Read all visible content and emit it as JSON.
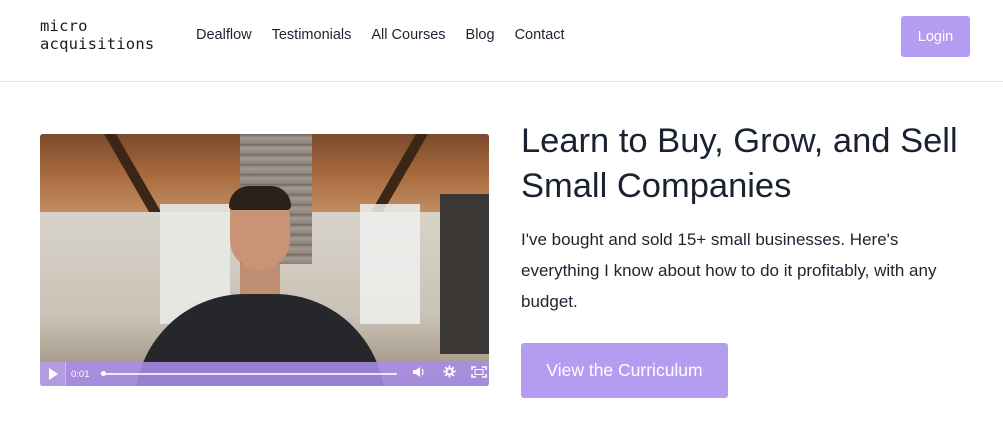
{
  "logo": {
    "line1": "micro",
    "line2": "acquisitions"
  },
  "nav": {
    "items": [
      {
        "label": "Dealflow"
      },
      {
        "label": "Testimonials"
      },
      {
        "label": "All Courses"
      },
      {
        "label": "Blog"
      },
      {
        "label": "Contact"
      }
    ],
    "login_label": "Login"
  },
  "video": {
    "current_time": "0:01",
    "controls": {
      "play_icon": "play-icon",
      "volume_icon": "volume-icon",
      "settings_icon": "gear-icon",
      "fullscreen_icon": "fullscreen-icon"
    }
  },
  "hero": {
    "title": "Learn to Buy, Grow, and Sell Small Companies",
    "description": "I've bought and sold 15+ small businesses. Here's everything I know about how to do it profitably, with any budget.",
    "cta_label": "View the Curriculum"
  },
  "colors": {
    "accent": "#b49cf0",
    "text": "#1a2130"
  }
}
